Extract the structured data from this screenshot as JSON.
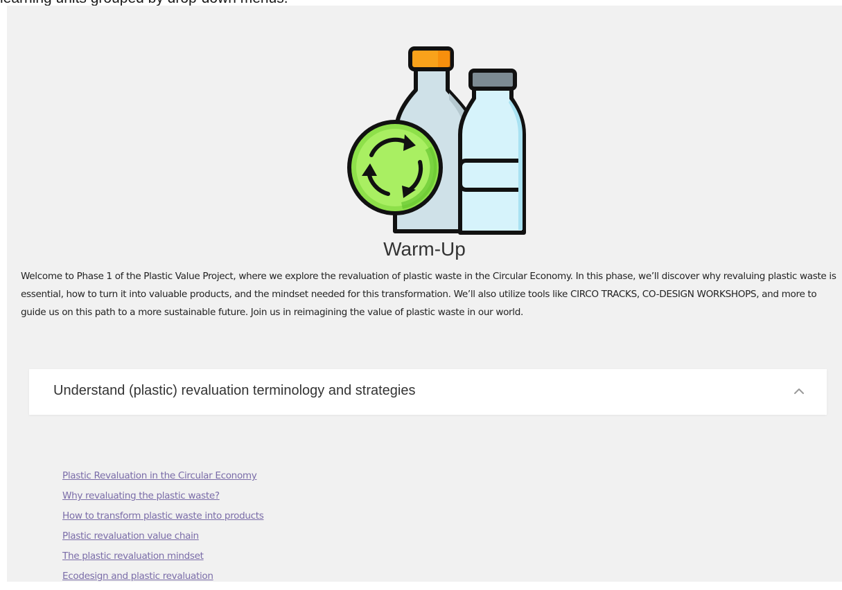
{
  "caption": "learning units grouped by drop-down menus.",
  "phase": {
    "title": "Warm-Up",
    "intro": "Welcome to Phase 1 of the Plastic Value Project, where we explore the revaluation of plastic waste in the Circular Economy. In this phase, we’ll discover why revaluing plastic waste is essential, how to turn it into valuable products, and the mindset needed for this transformation. We’ll also utilize tools like CIRCO TRACKS, CO-DESIGN WORKSHOPS, and more to guide us on this path to a more sustainable future. Join us in reimagining the value of plastic waste in our world."
  },
  "accordion": {
    "title": "Understand (plastic) revaluation terminology and strategies",
    "expanded": true,
    "icon": "chevron-up-icon"
  },
  "units": [
    "Plastic Revaluation in the Circular Economy",
    "Why revaluating the plastic waste?",
    "How to transform plastic waste into products",
    "Plastic revaluation value chain",
    "The plastic revaluation mindset",
    "Ecodesign and plastic revaluation"
  ],
  "colors": {
    "background": "#f1f1f1",
    "link": "#7a6ca8",
    "recycle_green": "#8ee04a",
    "cap_orange": "#f9a21b"
  },
  "illustration": {
    "icon": "plastic-bottles-recycle-icon"
  }
}
